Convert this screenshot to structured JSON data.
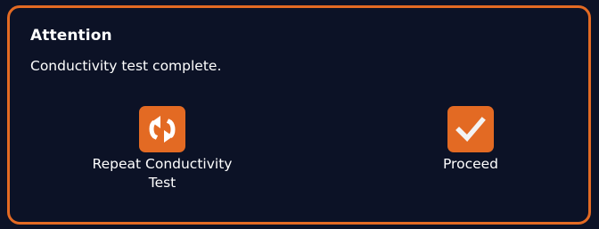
{
  "dialog": {
    "title": "Attention",
    "message": "Conductivity test complete.",
    "actions": [
      {
        "label": "Repeat Conductivity Test",
        "icon": "repeat-icon"
      },
      {
        "label": "Proceed",
        "icon": "checkmark-icon"
      }
    ]
  },
  "colors": {
    "background": "#0c1226",
    "accent": "#e36a23",
    "text": "#ffffff"
  }
}
